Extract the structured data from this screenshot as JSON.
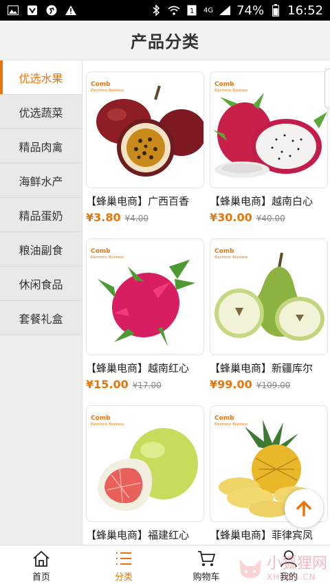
{
  "status_bar": {
    "network": "4G",
    "battery": "74%",
    "time": "16:52"
  },
  "header": {
    "title": "产品分类"
  },
  "sidebar": {
    "items": [
      {
        "label": "优选水果",
        "active": true
      },
      {
        "label": "优选蔬菜"
      },
      {
        "label": "精品肉禽"
      },
      {
        "label": "海鲜水产"
      },
      {
        "label": "精品蛋奶"
      },
      {
        "label": "粮油副食"
      },
      {
        "label": "休闲食品"
      },
      {
        "label": "套餐礼盒"
      }
    ]
  },
  "products": [
    {
      "brand": "Comb",
      "brand_sub": "Electronic Business",
      "title": "【蜂巢电商】广西百香",
      "price": "¥3.80",
      "old_price": "¥4.00",
      "fruit": "passion-fruit"
    },
    {
      "brand": "Comb",
      "brand_sub": "Electronic Business",
      "title": "【蜂巢电商】越南白心",
      "price": "¥30.00",
      "old_price": "¥40.00",
      "fruit": "white-dragon-fruit"
    },
    {
      "brand": "Comb",
      "brand_sub": "Electronic Business",
      "title": "【蜂巢电商】越南红心",
      "price": "¥15.00",
      "old_price": "¥17.00",
      "fruit": "red-dragon-fruit"
    },
    {
      "brand": "Comb",
      "brand_sub": "Electronic Business",
      "title": "【蜂巢电商】新疆库尔",
      "price": "¥99.00",
      "old_price": "¥109.00",
      "fruit": "pear"
    },
    {
      "brand": "Comb",
      "brand_sub": "Electronic Business",
      "title": "【蜂巢电商】福建红心",
      "price": "",
      "old_price": "",
      "fruit": "pomelo"
    },
    {
      "brand": "Comb",
      "brand_sub": "Electronic Business",
      "title": "【蜂巢电商】菲律宾凤",
      "price": "",
      "old_price": "",
      "fruit": "pineapple"
    }
  ],
  "tabbar": {
    "items": [
      {
        "label": "首页",
        "icon": "home-icon"
      },
      {
        "label": "分类",
        "icon": "list-icon",
        "active": true
      },
      {
        "label": "购物车",
        "icon": "cart-icon"
      },
      {
        "label": "我的",
        "icon": "user-icon"
      }
    ]
  },
  "watermark": {
    "cn": "小狐狸网",
    "en": "XHLWS.CN"
  },
  "colors": {
    "accent": "#e8740c",
    "text": "#222222"
  }
}
